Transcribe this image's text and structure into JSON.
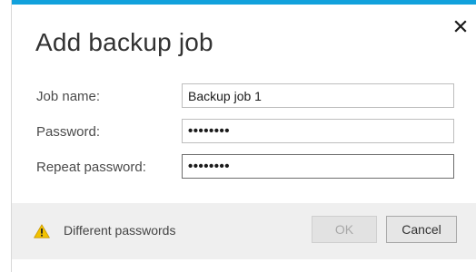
{
  "dialog": {
    "title": "Add backup job",
    "accent_color": "#12a1dc",
    "close_icon": "close-icon"
  },
  "form": {
    "job_name": {
      "label": "Job name:",
      "value": "Backup job 1"
    },
    "password": {
      "label": "Password:",
      "value": "secret12"
    },
    "repeat_password": {
      "label": "Repeat password:",
      "value": "secret13"
    }
  },
  "footer": {
    "warning_icon": "warning-icon",
    "warning_text": "Different passwords",
    "ok_label": "OK",
    "ok_enabled": false,
    "cancel_label": "Cancel"
  }
}
